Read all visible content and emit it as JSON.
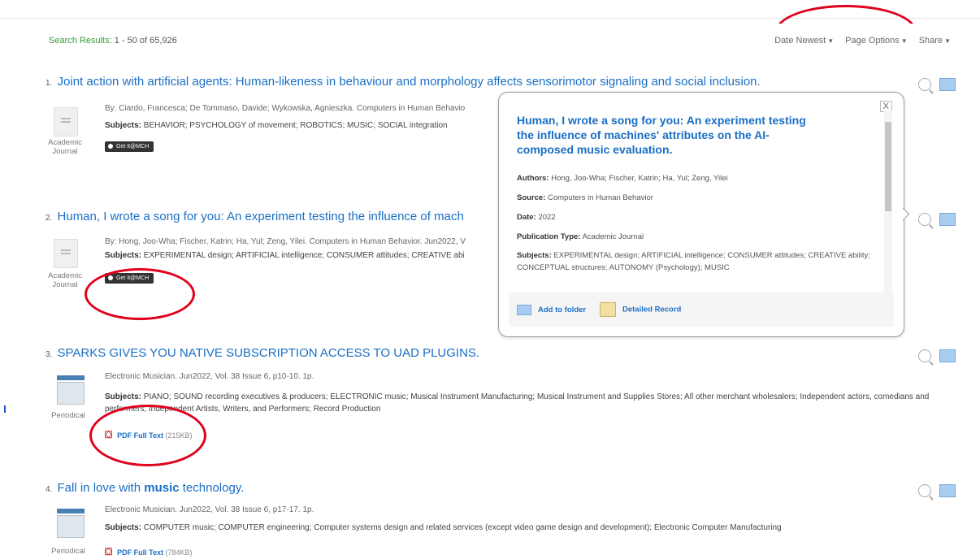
{
  "header": {
    "results_label": "Search Results:",
    "results_range": "1 - 50 of 65,926",
    "sort_label": "Date Newest",
    "page_options_label": "Page Options",
    "share_label": "Share"
  },
  "results": [
    {
      "index": "1.",
      "title": "Joint action with artificial agents: Human-likeness in behaviour and morphology affects sensorimotor signaling and social inclusion.",
      "meta": "By: Ciardo, Francesca; De Tommaso, Davide; Wykowska, Agnieszka. Computers in Human Behavio",
      "subjects_label": "Subjects:",
      "subjects": "BEHAVIOR; PSYCHOLOGY of movement; ROBOTICS; MUSIC; SOCIAL integration",
      "type": "Academic Journal",
      "getit": "Get It@MCH"
    },
    {
      "index": "2.",
      "title": "Human, I wrote a song for you: An experiment testing the influence of mach",
      "meta": "By: Hong, Joo-Wha; Fischer, Katrin; Ha, Yul; Zeng, Yilei. Computers in Human Behavior. Jun2022, V",
      "subjects_label": "Subjects:",
      "subjects": "EXPERIMENTAL design; ARTIFICIAL intelligence; CONSUMER attitudes; CREATIVE abi",
      "type": "Academic Journal",
      "getit": "Get It@MCH"
    },
    {
      "index": "3.",
      "title": "SPARKS GIVES YOU NATIVE SUBSCRIPTION ACCESS TO UAD PLUGINS.",
      "meta": "Electronic Musician. Jun2022, Vol. 38 Issue 6, p10-10. 1p.",
      "subjects_label": "Subjects:",
      "subjects": "PIANO; SOUND recording executives & producers; ELECTRONIC music; Musical Instrument Manufacturing; Musical Instrument and Supplies Stores; All other merchant wholesalers; Independent actors, comedians and performers; Independent Artists, Writers, and Performers; Record Production",
      "type": "Periodical",
      "pdf_label": "PDF Full Text",
      "pdf_size": "(215KB)"
    },
    {
      "index": "4.",
      "title_pre": "Fall in love with ",
      "title_bold": "music",
      "title_post": " technology.",
      "meta": "Electronic Musician. Jun2022, Vol. 38 Issue 6, p17-17. 1p.",
      "subjects_label": "Subjects:",
      "subjects": "COMPUTER music; COMPUTER engineering; Computer systems design and related services (except video game design and development); Electronic Computer Manufacturing",
      "type": "Periodical",
      "pdf_label": "PDF Full Text",
      "pdf_size": "(784KB)"
    }
  ],
  "popup": {
    "close": "X",
    "title": "Human, I wrote a song for you: An experiment testing the influence of machines' attributes on the AI-composed music evaluation.",
    "authors_label": "Authors:",
    "authors": "Hong, Joo-Wha; Fischer, Katrin; Ha, Yul; Zeng, Yilei",
    "source_label": "Source:",
    "source": "Computers in Human Behavior",
    "date_label": "Date:",
    "date": "2022",
    "pubtype_label": "Publication Type:",
    "pubtype": "Academic Journal",
    "subjects_label": "Subjects:",
    "subjects": "EXPERIMENTAL design; ARTIFICIAL intelligence; CONSUMER attitudes; CREATIVE ability; CONCEPTUAL structures; AUTONOMY (Psychology); MUSIC",
    "add_folder": "Add to folder",
    "detailed_record": "Detailed Record"
  },
  "colors": {
    "link": "#1a6fc4",
    "annotation": "#e0001a",
    "results_green": "#3b9a3b"
  }
}
